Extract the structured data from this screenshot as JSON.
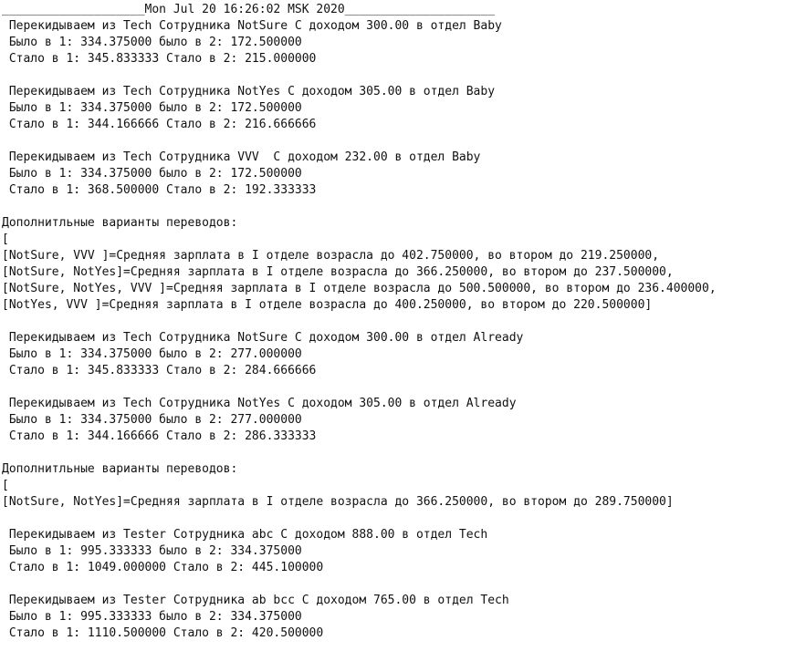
{
  "lines": [
    "____________________Mon Jul 20 16:26:02 MSK 2020_____________________",
    " Перекидываем из Tech Сотрудника NotSure С доходом 300.00 в отдел Baby",
    " Было в 1: 334.375000 было в 2: 172.500000",
    " Стало в 1: 345.833333 Стало в 2: 215.000000",
    "",
    " Перекидываем из Tech Сотрудника NotYes С доходом 305.00 в отдел Baby",
    " Было в 1: 334.375000 было в 2: 172.500000",
    " Стало в 1: 344.166666 Стало в 2: 216.666666",
    "",
    " Перекидываем из Tech Сотрудника VVV  С доходом 232.00 в отдел Baby",
    " Было в 1: 334.375000 было в 2: 172.500000",
    " Стало в 1: 368.500000 Стало в 2: 192.333333",
    "",
    "Дополнитльные варианты переводов:",
    "[",
    "[NotSure, VVV ]=Средняя зарплата в I отделе возрасла до 402.750000, во втором до 219.250000,",
    "[NotSure, NotYes]=Средняя зарплата в I отделе возрасла до 366.250000, во втором до 237.500000,",
    "[NotSure, NotYes, VVV ]=Средняя зарплата в I отделе возрасла до 500.500000, во втором до 236.400000,",
    "[NotYes, VVV ]=Средняя зарплата в I отделе возрасла до 400.250000, во втором до 220.500000]",
    "",
    " Перекидываем из Tech Сотрудника NotSure С доходом 300.00 в отдел Already",
    " Было в 1: 334.375000 было в 2: 277.000000",
    " Стало в 1: 345.833333 Стало в 2: 284.666666",
    "",
    " Перекидываем из Tech Сотрудника NotYes С доходом 305.00 в отдел Already",
    " Было в 1: 334.375000 было в 2: 277.000000",
    " Стало в 1: 344.166666 Стало в 2: 286.333333",
    "",
    "Дополнитльные варианты переводов:",
    "[",
    "[NotSure, NotYes]=Средняя зарплата в I отделе возрасла до 366.250000, во втором до 289.750000]",
    "",
    " Перекидываем из Tester Сотрудника abc С доходом 888.00 в отдел Tech",
    " Было в 1: 995.333333 было в 2: 334.375000",
    " Стало в 1: 1049.000000 Стало в 2: 445.100000",
    "",
    " Перекидываем из Tester Сотрудника ab bcc С доходом 765.00 в отдел Tech",
    " Было в 1: 995.333333 было в 2: 334.375000",
    " Стало в 1: 1110.500000 Стало в 2: 420.500000"
  ]
}
